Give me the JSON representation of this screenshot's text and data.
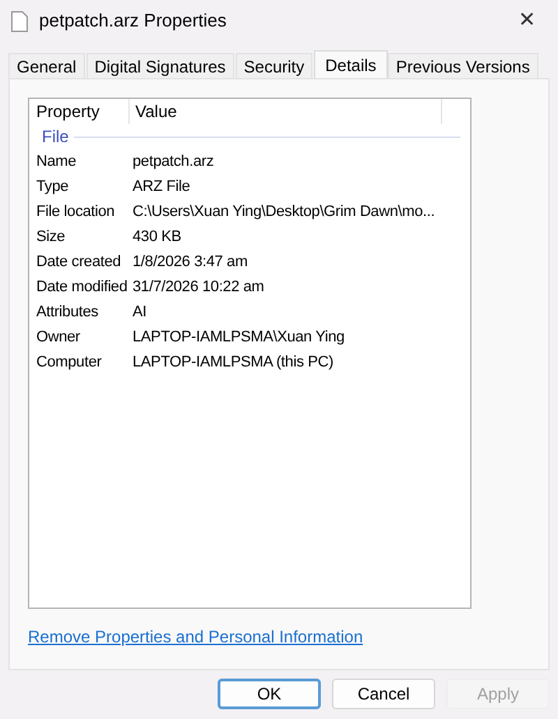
{
  "window": {
    "title": "petpatch.arz Properties",
    "close": "✕"
  },
  "tabs": [
    {
      "label": "General",
      "selected": false
    },
    {
      "label": "Digital Signatures",
      "selected": false
    },
    {
      "label": "Security",
      "selected": false
    },
    {
      "label": "Details",
      "selected": true
    },
    {
      "label": "Previous Versions",
      "selected": false
    }
  ],
  "table": {
    "columns": [
      "Property",
      "Value"
    ],
    "group": "File",
    "rows": [
      {
        "property": "Name",
        "value": "petpatch.arz"
      },
      {
        "property": "Type",
        "value": "ARZ File"
      },
      {
        "property": "File location",
        "value": "C:\\Users\\Xuan Ying\\Desktop\\Grim Dawn\\mo..."
      },
      {
        "property": "Size",
        "value": "430 KB"
      },
      {
        "property": "Date created",
        "value": "1/8/2026 3:47 am"
      },
      {
        "property": "Date modified",
        "value": "31/7/2026 10:22 am"
      },
      {
        "property": "Attributes",
        "value": "AI"
      },
      {
        "property": "Owner",
        "value": "LAPTOP-IAMLPSMA\\Xuan Ying"
      },
      {
        "property": "Computer",
        "value": "LAPTOP-IAMLPSMA (this PC)"
      }
    ]
  },
  "link": "Remove Properties and Personal Information",
  "buttons": [
    {
      "label": "OK",
      "default": true,
      "disabled": false
    },
    {
      "label": "Cancel",
      "default": false,
      "disabled": false
    },
    {
      "label": "Apply",
      "default": false,
      "disabled": true
    }
  ]
}
